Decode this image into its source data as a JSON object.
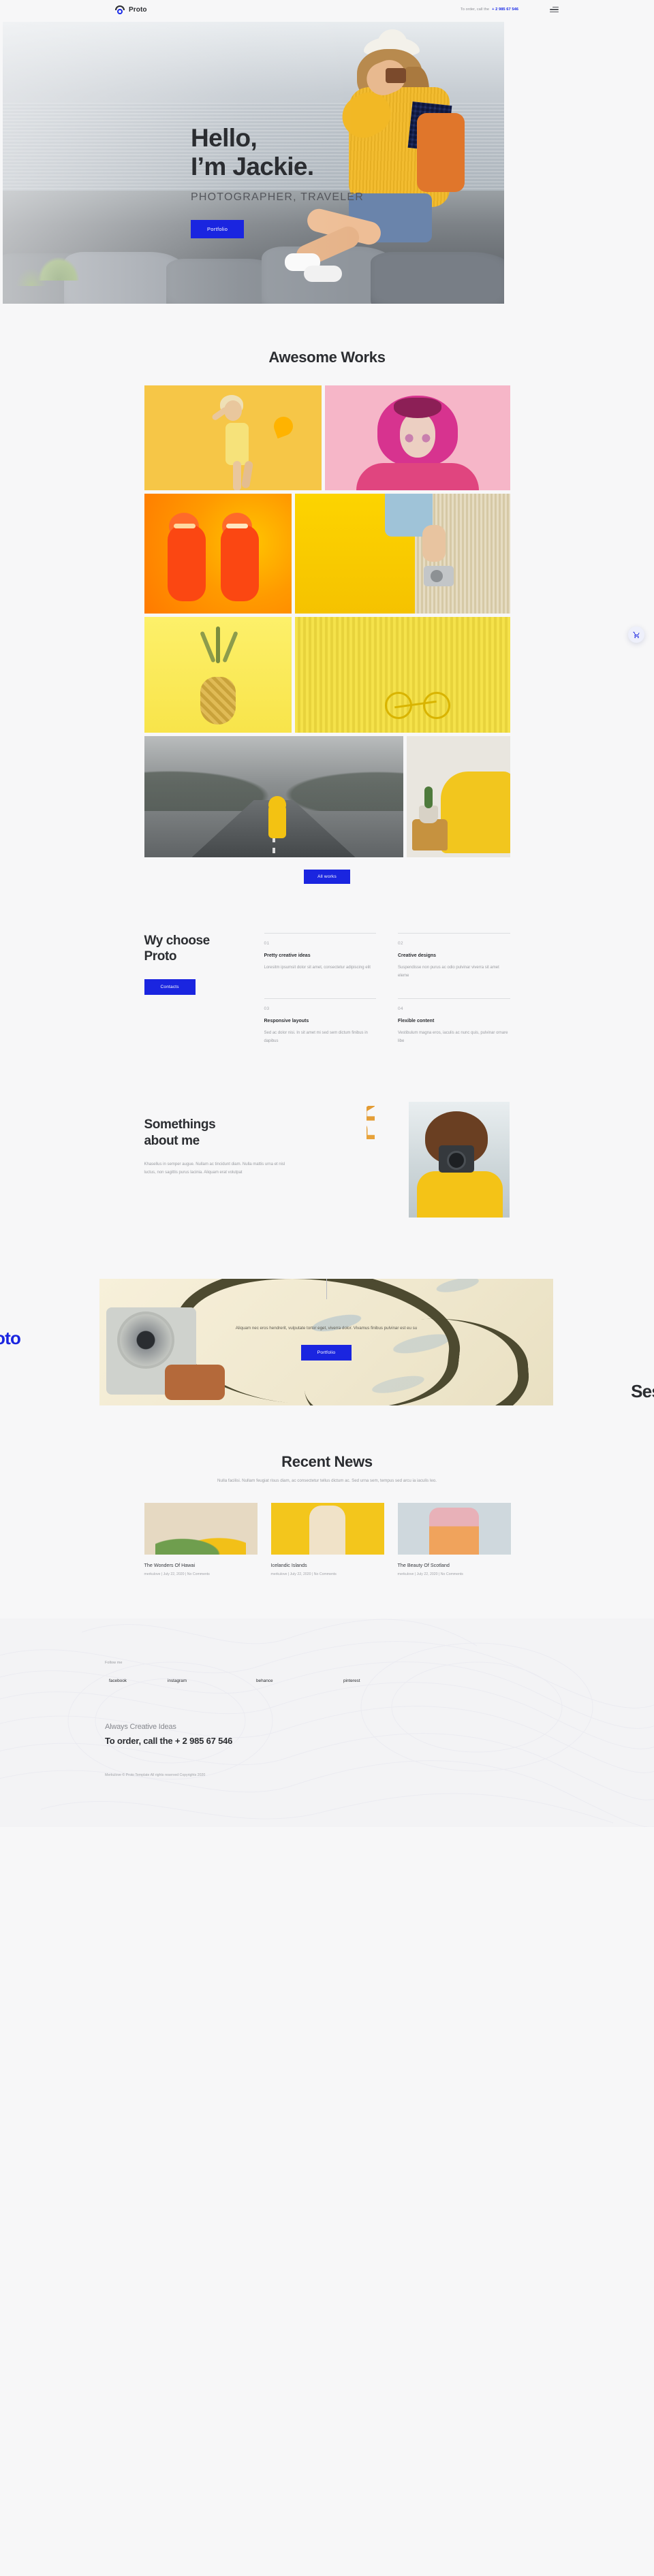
{
  "header": {
    "brand": "Proto",
    "contact_label": "To order, call the",
    "phone": "+ 2 985 67 546",
    "menu_icon": "hamburger-menu-icon"
  },
  "hero": {
    "title_line1": "Hello,",
    "title_line2": "I’m Jackie.",
    "subtitle": "PHOTOGRAPHER, TRAVELER",
    "cta": "Portfolio"
  },
  "works": {
    "title": "Awesome Works",
    "cta": "All works",
    "tiles": [
      {
        "name": "yellow-lemon-girl"
      },
      {
        "name": "pink-hair-portrait"
      },
      {
        "name": "orange-duo-swimsuit"
      },
      {
        "name": "yellow-wall-camera"
      },
      {
        "name": "pineapple-yellow"
      },
      {
        "name": "yellow-fence-bicycle"
      },
      {
        "name": "foggy-road-yellow-raincoat"
      },
      {
        "name": "yellow-armchair-cactus"
      }
    ]
  },
  "why": {
    "title_line1": "Wy choose",
    "title_line2": "Proto",
    "cta": "Contacts",
    "features": [
      {
        "num": "01",
        "title": "Pretty creative ideas",
        "text": "Loresitm ipsumsit dolor sit amet, consectetur adipiscing elit"
      },
      {
        "num": "02",
        "title": "Creative designs",
        "text": "Suspendisse non purus ac odio pulvinar viverra sit amet eleme"
      },
      {
        "num": "03",
        "title": "Responsive layouts",
        "text": "Sed ac dolor nisi. In sit amet mi sed sem dictum finibus in dapibus"
      },
      {
        "num": "04",
        "title": "Flexible content",
        "text": "Vestibulum magna eros, iaculis ac nunc quis, pulvinar ornare libe"
      }
    ]
  },
  "about": {
    "title_line1": "Somethings",
    "title_line2": "about me",
    "text": "Khasellus in semper augue. Nullam ac tincidunt diam. Nulla mattis urna et nisl luctus, non sagittis purus lacinia. Aliquam erat volutpat",
    "letters": "PROTO"
  },
  "banner": {
    "marquee_left": "oto",
    "marquee_right": "Ses",
    "text": "Aliquam nec eros hendrerit, vulputate tortor eget, viverra dolor. Vivamus finibus pulvinar est eu su",
    "cta": "Portfolio"
  },
  "news": {
    "title": "Recent News",
    "subtitle": "Nulla facilisi. Nullam feugiat risus diam, ac consectetur tellus dictum ac. Sed urna sem, tempus sed arcu ia iaculis leo.",
    "cards": [
      {
        "title": "The Wonders Of Hawai",
        "meta": "merkulove | July 22, 2020 | No Comments"
      },
      {
        "title": "Icelandic Islands",
        "meta": "merkulove | July 22, 2020 | No Comments"
      },
      {
        "title": "The Beauty Of Scotland",
        "meta": "merkulove | July 22, 2020 | No Comments"
      }
    ]
  },
  "footer": {
    "follow_label": "Follow me",
    "socials": [
      "facebook",
      "instagram",
      "behance",
      "pinterest"
    ],
    "cta_line1": "Always Creative Ideas",
    "cta_line2": "To order, call the + 2 985 67 546",
    "copyright": "Merkulove © Proto Template All rights reserved Copyrights 2020"
  },
  "widgets": {
    "cart_icon": "shopping-cart-icon"
  },
  "colors": {
    "accent_blue": "#1a25e0",
    "page_bg": "#f7f7f8",
    "text_dark": "#2b2d31",
    "text_muted": "#9a9ca1"
  }
}
